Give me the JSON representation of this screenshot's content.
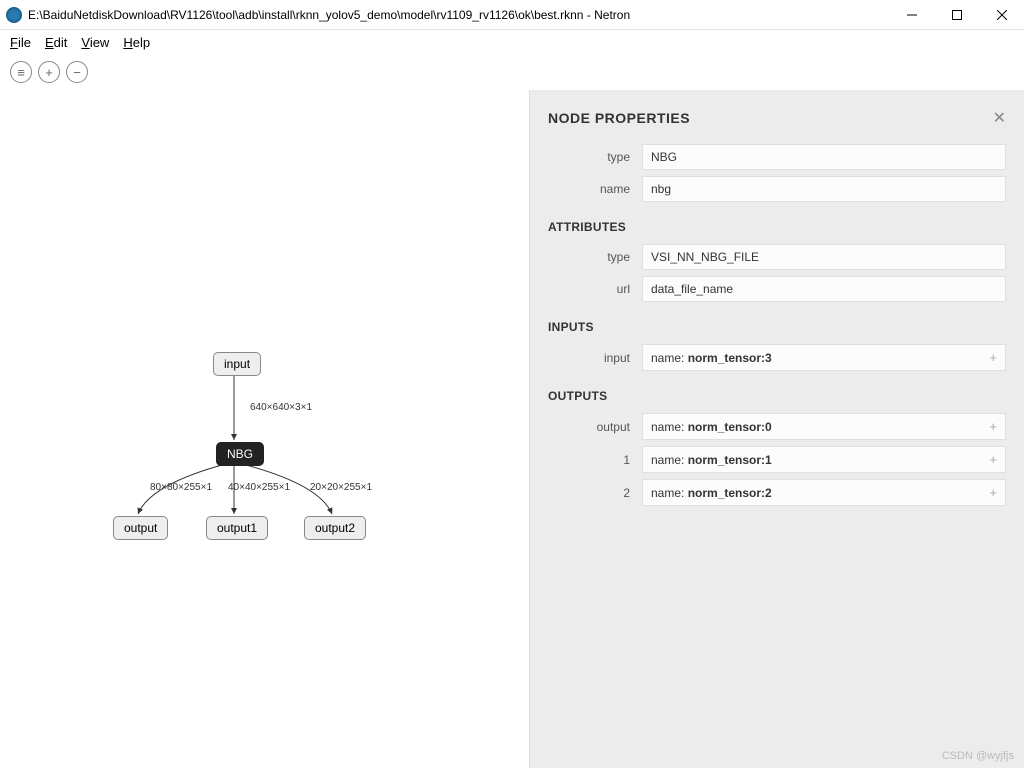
{
  "window": {
    "title": "E:\\BaiduNetdiskDownload\\RV1126\\tool\\adb\\install\\rknn_yolov5_demo\\model\\rv1109_rv1126\\ok\\best.rknn - Netron"
  },
  "menu": {
    "file": "File",
    "edit": "Edit",
    "view": "View",
    "help": "Help"
  },
  "toolbar": {
    "list": "≡",
    "plus": "+",
    "minus": "−"
  },
  "graph": {
    "input": "input",
    "nbg": "NBG",
    "output0": "output",
    "output1": "output1",
    "output2": "output2",
    "edge_in": "640×640×3×1",
    "edge_o0": "80×80×255×1",
    "edge_o1": "40×40×255×1",
    "edge_o2": "20×20×255×1"
  },
  "panel": {
    "title": "NODE PROPERTIES",
    "type_label": "type",
    "type_value": "NBG",
    "name_label": "name",
    "name_value": "nbg",
    "attr_title": "ATTRIBUTES",
    "attr_type_label": "type",
    "attr_type_value": "VSI_NN_NBG_FILE",
    "attr_url_label": "url",
    "attr_url_value": "data_file_name",
    "inputs_title": "INPUTS",
    "input_label": "input",
    "input_name_prefix": "name: ",
    "input_name": "norm_tensor:3",
    "outputs_title": "OUTPUTS",
    "out0_label": "output",
    "out0_name": "norm_tensor:0",
    "out1_label": "1",
    "out1_name": "norm_tensor:1",
    "out2_label": "2",
    "out2_name": "norm_tensor:2"
  },
  "watermark": "CSDN @wyjfjs"
}
